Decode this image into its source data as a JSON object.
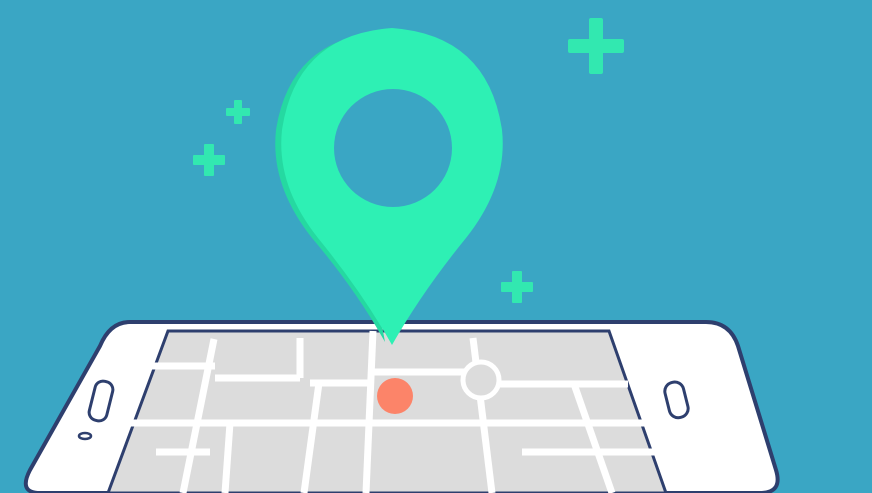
{
  "scene": {
    "description_label": "",
    "colors": {
      "background": "#3aa6c4",
      "pin": "#2ef0b4",
      "pin_shade": "#25d9a1",
      "sparkle": "#32e8b0",
      "phone_body": "#ffffff",
      "phone_outline": "#2e3f6e",
      "map_background": "#dcdcdc",
      "map_roads": "#ffffff",
      "location_dot": "#ff7a5c"
    },
    "icons": {
      "pin": "map-pin-icon",
      "sparkle": "plus-sparkle-icon",
      "phone": "smartphone-icon",
      "home_button": "home-button-icon",
      "earpiece": "speaker-slot-icon",
      "current_location": "location-dot-icon",
      "roundabout": "roundabout-ring-icon"
    }
  }
}
